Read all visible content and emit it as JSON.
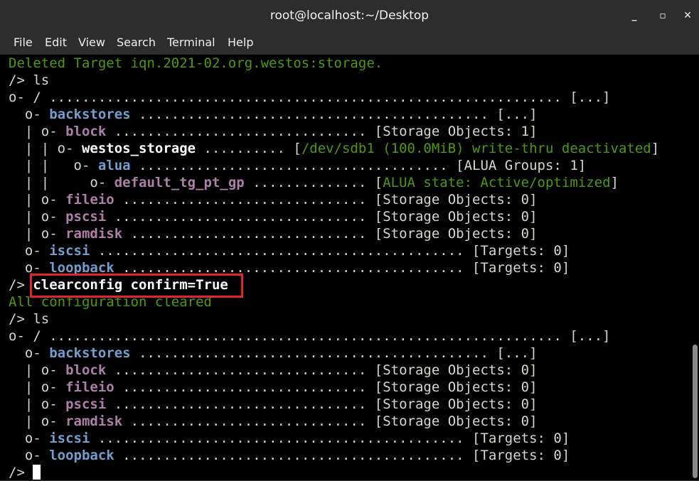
{
  "window": {
    "title": "root@localhost:~/Desktop",
    "controls": {
      "minimize": "_",
      "maximize": "▫",
      "close": "✕"
    }
  },
  "menu": [
    "File",
    "Edit",
    "View",
    "Search",
    "Terminal",
    "Help"
  ],
  "terminal": {
    "colors": {
      "background": "#000000",
      "text": "#d3d7cf",
      "blue": "#729fcf",
      "magenta": "#ad7fa8",
      "green": "#4e9a06",
      "highlight": "#e3252f"
    },
    "highlighted_command": "clearconfig confirm=True",
    "lines": [
      [
        [
          "gr",
          "Deleted Target iqn.2021-02.org.westos:storage."
        ]
      ],
      [
        [
          "",
          "/> ls"
        ]
      ],
      [
        [
          "",
          "o- / ............................................................... [...]"
        ]
      ],
      [
        [
          "",
          "  o- "
        ],
        [
          "bl",
          "backstores"
        ],
        [
          "",
          " ........................................... [...]"
        ]
      ],
      [
        [
          "",
          "  | o- "
        ],
        [
          "mg",
          "block"
        ],
        [
          "",
          " ............................... [Storage Objects: 1]"
        ]
      ],
      [
        [
          "",
          "  | | o- "
        ],
        [
          "wh",
          "westos_storage"
        ],
        [
          "",
          " .......... ["
        ],
        [
          "gr",
          "/dev/sdb1 (100.0MiB) write-thru deactivated"
        ],
        [
          "",
          "]"
        ]
      ],
      [
        [
          "",
          "  | |   o- "
        ],
        [
          "bl",
          "alua"
        ],
        [
          "",
          " ...................................... [ALUA Groups: 1]"
        ]
      ],
      [
        [
          "",
          "  | |     o- "
        ],
        [
          "mg",
          "default_tg_pt_gp"
        ],
        [
          "",
          " .............. ["
        ],
        [
          "gr",
          "ALUA state: Active/optimized"
        ],
        [
          "",
          "]"
        ]
      ],
      [
        [
          "",
          "  | o- "
        ],
        [
          "mg",
          "fileio"
        ],
        [
          "",
          " .............................. [Storage Objects: 0]"
        ]
      ],
      [
        [
          "",
          "  | o- "
        ],
        [
          "mg",
          "pscsi"
        ],
        [
          "",
          " ............................... [Storage Objects: 0]"
        ]
      ],
      [
        [
          "",
          "  | o- "
        ],
        [
          "mg",
          "ramdisk"
        ],
        [
          "",
          " ............................. [Storage Objects: 0]"
        ]
      ],
      [
        [
          "",
          "  o- "
        ],
        [
          "bl",
          "iscsi"
        ],
        [
          "",
          " ............................................. [Targets: 0]"
        ]
      ],
      [
        [
          "",
          "  o- "
        ],
        [
          "bl",
          "loopback"
        ],
        [
          "",
          " .......................................... [Targets: 0]"
        ]
      ],
      [
        [
          "",
          "/> "
        ],
        [
          "wh",
          "clearconfig confirm=True"
        ]
      ],
      [
        [
          "gr",
          "All configuration cleared"
        ]
      ],
      [
        [
          "",
          "/> ls"
        ]
      ],
      [
        [
          "",
          "o- / ............................................................... [...]"
        ]
      ],
      [
        [
          "",
          "  o- "
        ],
        [
          "bl",
          "backstores"
        ],
        [
          "",
          " ........................................... [...]"
        ]
      ],
      [
        [
          "",
          "  | o- "
        ],
        [
          "mg",
          "block"
        ],
        [
          "",
          " ............................... [Storage Objects: 0]"
        ]
      ],
      [
        [
          "",
          "  | o- "
        ],
        [
          "mg",
          "fileio"
        ],
        [
          "",
          " .............................. [Storage Objects: 0]"
        ]
      ],
      [
        [
          "",
          "  | o- "
        ],
        [
          "mg",
          "pscsi"
        ],
        [
          "",
          " ............................... [Storage Objects: 0]"
        ]
      ],
      [
        [
          "",
          "  | o- "
        ],
        [
          "mg",
          "ramdisk"
        ],
        [
          "",
          " ............................. [Storage Objects: 0]"
        ]
      ],
      [
        [
          "",
          "  o- "
        ],
        [
          "bl",
          "iscsi"
        ],
        [
          "",
          " ............................................. [Targets: 0]"
        ]
      ],
      [
        [
          "",
          "  o- "
        ],
        [
          "bl",
          "loopback"
        ],
        [
          "",
          " .......................................... [Targets: 0]"
        ]
      ]
    ],
    "prompt": "/> "
  }
}
